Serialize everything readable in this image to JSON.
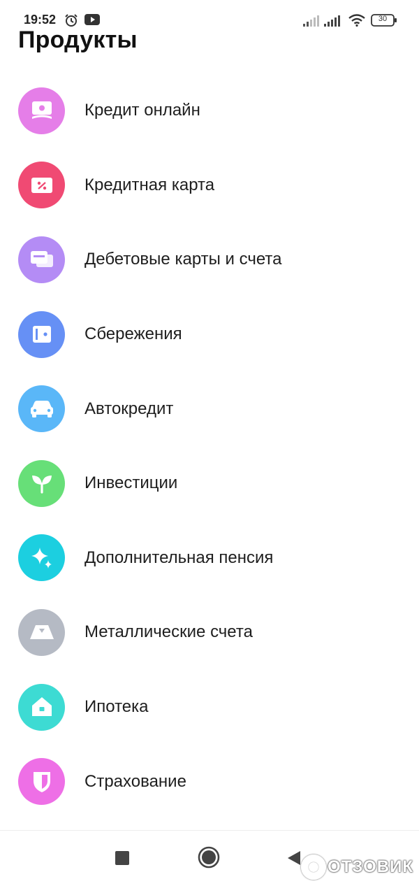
{
  "status_bar": {
    "time": "19:52",
    "battery": "30",
    "icons": [
      "alarm-icon",
      "youtube-icon",
      "signal-icon",
      "signal-icon",
      "wifi-icon",
      "battery-icon"
    ]
  },
  "page": {
    "title": "Продукты"
  },
  "products": [
    {
      "label": "Кредит онлайн",
      "icon": "cash-icon",
      "color": "#e57ee8"
    },
    {
      "label": "Кредитная карта",
      "icon": "percent-card-icon",
      "color": "#f04a73"
    },
    {
      "label": "Дебетовые карты и счета",
      "icon": "cards-icon",
      "color": "#b48cf5"
    },
    {
      "label": "Сбережения",
      "icon": "safe-icon",
      "color": "#6690f5"
    },
    {
      "label": "Автокредит",
      "icon": "car-icon",
      "color": "#5ab7f8"
    },
    {
      "label": "Инвестиции",
      "icon": "sprout-icon",
      "color": "#67df78"
    },
    {
      "label": "Дополнительная пенсия",
      "icon": "sparkle-icon",
      "color": "#1ccfe0"
    },
    {
      "label": "Металлические счета",
      "icon": "gold-bar-icon",
      "color": "#b5bac4"
    },
    {
      "label": "Ипотека",
      "icon": "house-icon",
      "color": "#3ddbd3"
    },
    {
      "label": "Страхование",
      "icon": "shield-icon",
      "color": "#ee6fe6"
    }
  ],
  "navigation": {
    "buttons": [
      "recents-icon",
      "home-icon",
      "back-icon"
    ]
  },
  "watermark": {
    "text": "ОТЗОВИК"
  }
}
